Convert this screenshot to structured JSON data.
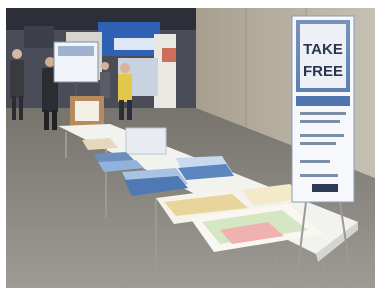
{
  "photo": {
    "description_free": true,
    "sign": {
      "headline_line1": "TAKE",
      "headline_line2": "FREE"
    },
    "colors": {
      "sign_blue": "#7f9dc6",
      "wall_concrete": "#b7b0a2",
      "floor": "#8e8b86",
      "table_white": "#f2f2ef",
      "booth_blue": "#2f62b4"
    }
  }
}
